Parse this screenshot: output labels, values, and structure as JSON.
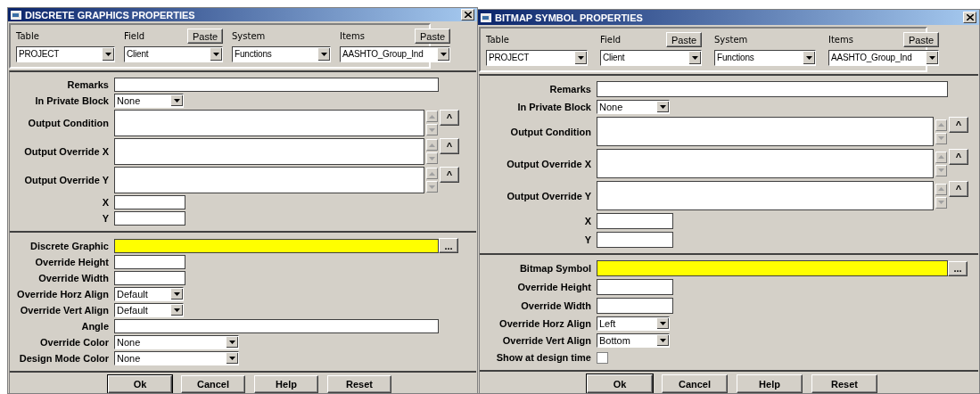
{
  "windows": [
    {
      "title": "DISCRETE GRAPHICS PROPERTIES",
      "header": [
        {
          "label": "Table",
          "value": "PROJECT"
        },
        {
          "label": "Field",
          "value": "Client",
          "paste": "Paste"
        },
        {
          "label": "System",
          "value": "Functions"
        },
        {
          "label": "Items",
          "value": "AASHTO_Group_Ind",
          "paste": "Paste"
        }
      ],
      "sections": [
        [
          {
            "kind": "text",
            "label": "Remarks"
          },
          {
            "kind": "dropdown",
            "label": "In Private Block",
            "value": "None"
          },
          {
            "kind": "memo",
            "label": "Output Condition",
            "expand": "^"
          },
          {
            "kind": "memo",
            "label": "Output Override X",
            "expand": "^"
          },
          {
            "kind": "memo",
            "label": "Output Override Y",
            "expand": "^"
          },
          {
            "kind": "short-text",
            "label": "X"
          },
          {
            "kind": "short-text",
            "label": "Y"
          }
        ],
        [
          {
            "kind": "browse",
            "label": "Discrete Graphic",
            "browse": "..."
          },
          {
            "kind": "short-text",
            "label": "Override Height"
          },
          {
            "kind": "short-text",
            "label": "Override Width"
          },
          {
            "kind": "dropdown",
            "label": "Override Horz Align",
            "value": "Default"
          },
          {
            "kind": "dropdown",
            "label": "Override Vert Align",
            "value": "Default"
          },
          {
            "kind": "text",
            "label": "Angle"
          },
          {
            "kind": "wide-dropdown",
            "label": "Override Color",
            "value": "None"
          },
          {
            "kind": "wide-dropdown",
            "label": "Design Mode Color",
            "value": "None"
          }
        ]
      ],
      "buttons": [
        {
          "label": "Ok",
          "default": true
        },
        {
          "label": "Cancel",
          "default": false
        },
        {
          "label": "Help",
          "default": false
        },
        {
          "label": "Reset",
          "default": false
        }
      ]
    },
    {
      "title": "BITMAP SYMBOL PROPERTIES",
      "header": [
        {
          "label": "Table",
          "value": "PROJECT"
        },
        {
          "label": "Field",
          "value": "Client",
          "paste": "Paste"
        },
        {
          "label": "System",
          "value": "Functions"
        },
        {
          "label": "Items",
          "value": "AASHTO_Group_Ind",
          "paste": "Paste"
        }
      ],
      "sections": [
        [
          {
            "kind": "text",
            "label": "Remarks"
          },
          {
            "kind": "dropdown",
            "label": "In Private Block",
            "value": "None"
          },
          {
            "kind": "memo",
            "label": "Output Condition",
            "expand": "^"
          },
          {
            "kind": "memo",
            "label": "Output Override X",
            "expand": "^"
          },
          {
            "kind": "memo",
            "label": "Output Override Y",
            "expand": "^"
          },
          {
            "kind": "short-text",
            "label": "X"
          },
          {
            "kind": "short-text",
            "label": "Y"
          }
        ],
        [
          {
            "kind": "browse",
            "label": "Bitmap Symbol",
            "browse": "..."
          },
          {
            "kind": "short-text",
            "label": "Override Height"
          },
          {
            "kind": "short-text",
            "label": "Override Width"
          },
          {
            "kind": "dropdown",
            "label": "Override Horz Align",
            "value": "Left"
          },
          {
            "kind": "dropdown",
            "label": "Override Vert Align",
            "value": "Bottom"
          },
          {
            "kind": "checkbox",
            "label": "Show at design time",
            "checked": false
          }
        ]
      ],
      "buttons": [
        {
          "label": "Ok",
          "default": true
        },
        {
          "label": "Cancel",
          "default": false
        },
        {
          "label": "Help",
          "default": false
        },
        {
          "label": "Reset",
          "default": false
        }
      ]
    }
  ]
}
